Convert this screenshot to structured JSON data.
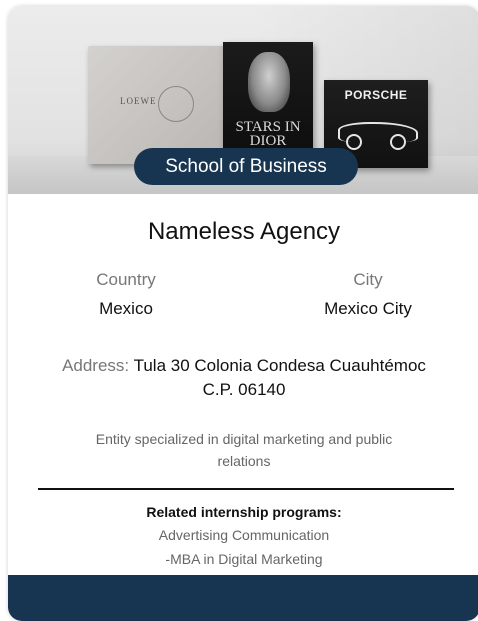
{
  "card": {
    "badge": "School of Business",
    "hero_books": {
      "loewe_text": "LOEWE",
      "dior_text": "STARS IN DIOR",
      "porsche_text": "PORSCHE"
    },
    "agency_name": "Nameless Agency",
    "country_label": "Country",
    "country_value": "Mexico",
    "city_label": "City",
    "city_value": "Mexico City",
    "address_label": "Address:",
    "address_value": "Tula 30 Colonia Condesa Cuauhtémoc C.P. 06140",
    "description": "Entity specialized in digital marketing and public relations",
    "related_title": "Related internship programs:",
    "programs": [
      "Advertising Communication",
      "-MBA in Digital Marketing"
    ]
  },
  "colors": {
    "accent": "#173450",
    "muted_text": "#777777"
  }
}
